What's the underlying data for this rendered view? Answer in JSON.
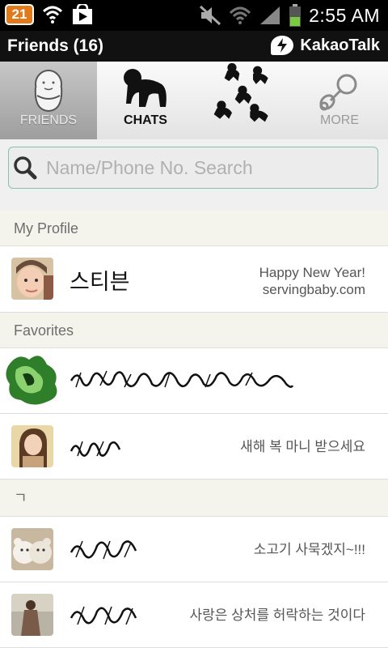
{
  "status_bar": {
    "notification_count": "21",
    "time": "2:55 AM",
    "icons": [
      "wifi-icon",
      "play-store-icon",
      "mute-icon",
      "wifi-signal-icon",
      "cell-signal-icon",
      "battery-icon"
    ]
  },
  "header": {
    "title": "Friends (16)",
    "app_name": "KakaoTalk"
  },
  "tabs": [
    {
      "label": "FRIENDS",
      "active": true
    },
    {
      "label": "CHATS",
      "active": false
    },
    {
      "label": "",
      "active": false
    },
    {
      "label": "MORE",
      "active": false
    }
  ],
  "search": {
    "placeholder": "Name/Phone No. Search",
    "value": ""
  },
  "sections": {
    "my_profile": "My Profile",
    "favorites": "Favorites",
    "index_letter": "ㄱ"
  },
  "profile": {
    "name": "스티븐",
    "status_line1": "Happy New Year!",
    "status_line2": "servingbaby.com"
  },
  "friends": [
    {
      "status": ""
    },
    {
      "status": "새해 복 마니 받으세요"
    },
    {
      "status": "소고기 사묵겠지~!!!"
    },
    {
      "status": "사랑은 상처를 허락하는 것이다"
    }
  ],
  "colors": {
    "notification_badge": "#e07a1a",
    "battery_fill": "#7ac943",
    "search_border": "#8cc0a8"
  }
}
